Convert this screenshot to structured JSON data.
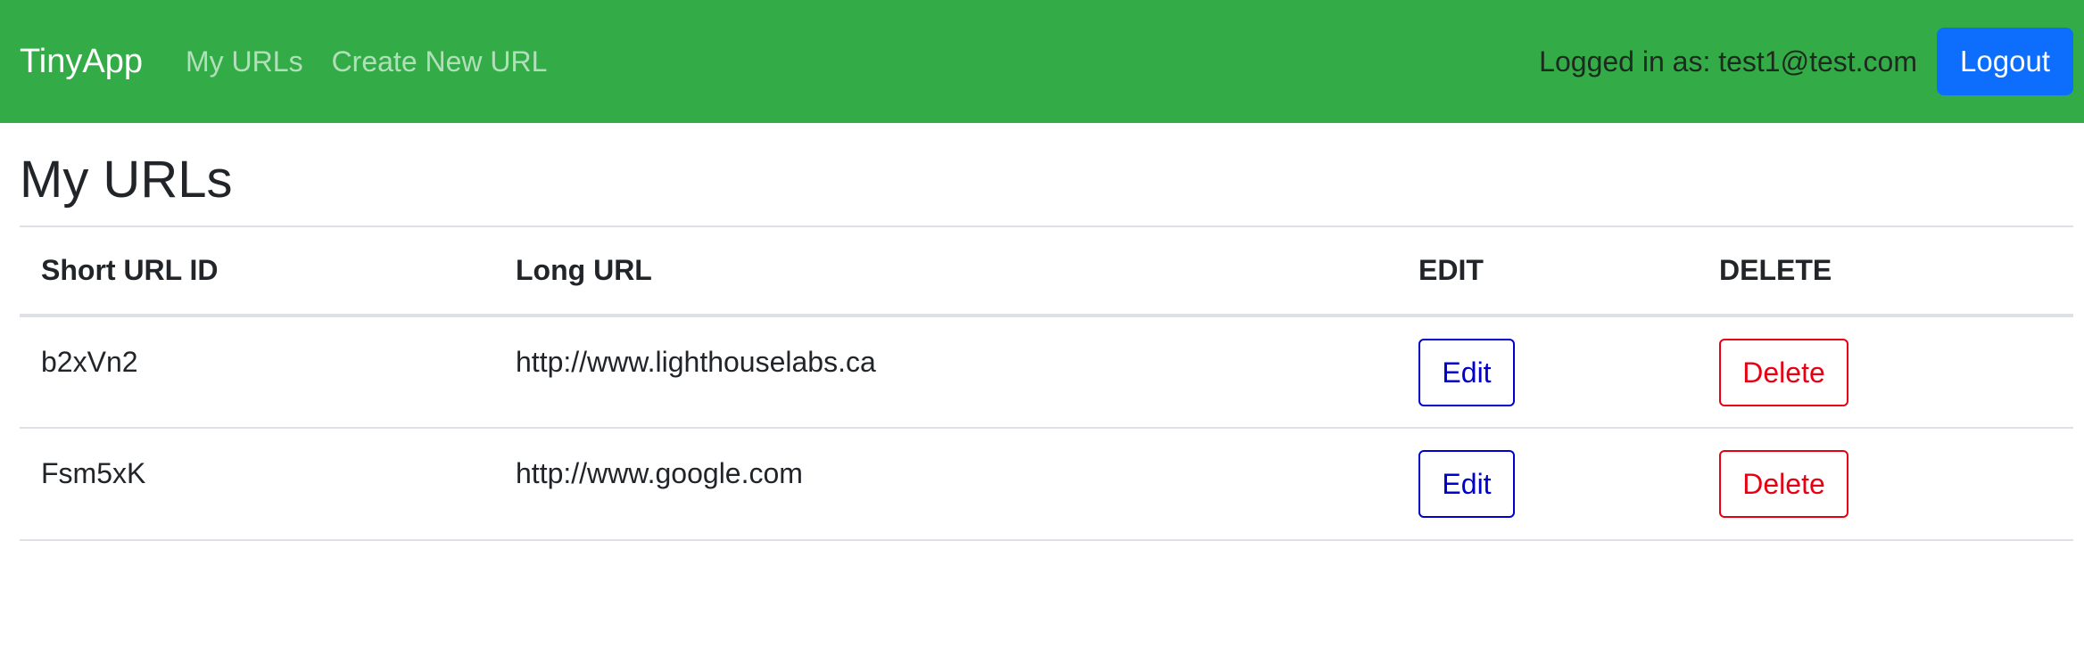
{
  "navbar": {
    "brand": "TinyApp",
    "links": [
      {
        "label": "My URLs"
      },
      {
        "label": "Create New URL"
      }
    ],
    "logged_in_text": "Logged in as: test1@test.com",
    "logout_label": "Logout",
    "colors": {
      "background": "#33ac47",
      "logout": "#0d6efd"
    }
  },
  "main": {
    "title": "My URLs",
    "table": {
      "headers": [
        "Short URL ID",
        "Long URL",
        "EDIT",
        "DELETE"
      ],
      "rows": [
        {
          "short_id": "b2xVn2",
          "long_url": "http://www.lighthouselabs.ca",
          "edit_label": "Edit",
          "delete_label": "Delete"
        },
        {
          "short_id": "Fsm5xK",
          "long_url": "http://www.google.com",
          "edit_label": "Edit",
          "delete_label": "Delete"
        }
      ]
    },
    "colors": {
      "edit": "#0000cc",
      "delete": "#e60012"
    }
  }
}
